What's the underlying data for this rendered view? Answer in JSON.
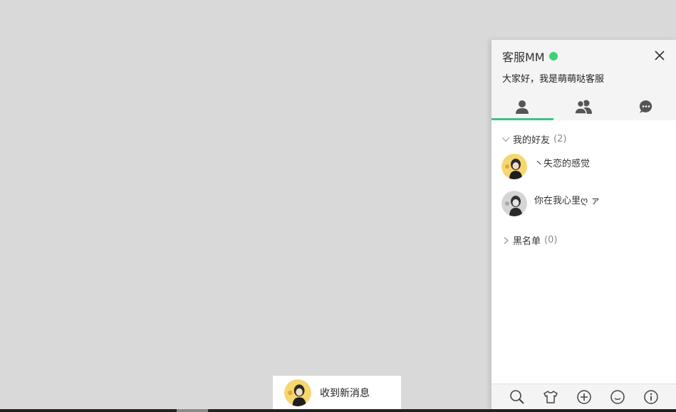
{
  "panel": {
    "title": "客服MM",
    "status_color": "#3fd07a",
    "signature": "大家好，我是萌萌哒客服",
    "tabs": [
      {
        "icon": "single-user-icon",
        "active": true
      },
      {
        "icon": "group-users-icon",
        "active": false
      },
      {
        "icon": "chat-bubble-icon",
        "active": false
      }
    ],
    "accent_color": "#3fc287"
  },
  "groups": {
    "friends": {
      "label": "我的好友",
      "count": "(2)",
      "expanded": true
    },
    "blacklist": {
      "label": "黑名单",
      "count": "(0)",
      "expanded": false
    }
  },
  "friends": [
    {
      "name": "丶失恋的感觉",
      "avatar_bg": "#f5d76e",
      "online": true
    },
    {
      "name": "你在我心里ღ ァ",
      "avatar_bg": "#d0d0d0",
      "online": false
    }
  ],
  "footer": {
    "icons": [
      "search-icon",
      "skin-shirt-icon",
      "add-icon",
      "emoji-icon",
      "info-icon"
    ]
  },
  "notification": {
    "text": "收到新消息"
  }
}
